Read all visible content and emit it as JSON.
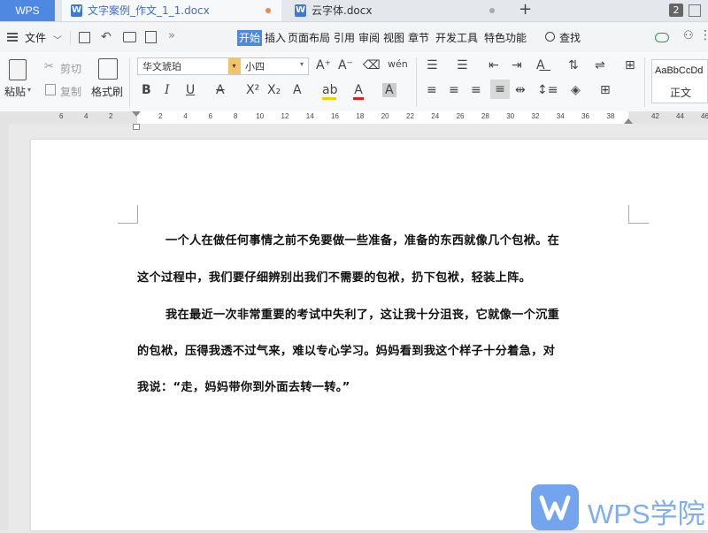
{
  "tabs": {
    "wps_label": "WPS",
    "doc1": "文字案例_作文_1_1.docx",
    "doc2": "云字体.docx",
    "add_icon": "+",
    "window_count": "2"
  },
  "menu": {
    "file_label": "文件",
    "items": [
      "开始",
      "插入",
      "页面布局",
      "引用",
      "审阅",
      "视图",
      "章节",
      "开发工具",
      "特色功能"
    ],
    "search_label": "查找"
  },
  "ribbon": {
    "paste_label": "粘贴",
    "cut_label": "剪切",
    "copy_label": "复制",
    "format_painter_label": "格式刷",
    "font_name": "华文琥珀",
    "font_size": "小四",
    "style_preview": "AaBbCcDd",
    "style_name": "正文",
    "fmt_buttons": [
      "B",
      "I",
      "U",
      "A",
      "X²",
      "X₂",
      "A",
      "A",
      "A"
    ]
  },
  "ruler": {
    "left_ticks": [
      "6",
      "4",
      "2"
    ],
    "right_ticks": [
      "2",
      "4",
      "6",
      "8",
      "10",
      "12",
      "14",
      "16",
      "18",
      "20",
      "22",
      "24",
      "26",
      "28",
      "30",
      "32",
      "34",
      "36",
      "38"
    ],
    "far_ticks": [
      "42",
      "44",
      "46"
    ]
  },
  "document": {
    "para1_line1": "一个人在做任何事情之前不免要做一些准备，准备的东西就像几个包袱。在",
    "para1_line2": "这个过程中，我们要仔细辨别出我们不需要的包袱，扔下包袱，轻装上阵。",
    "para2_line1": "我在最近一次非常重要的考试中失利了，这让我十分沮丧，它就像一个沉重",
    "para2_line2": "的包袱，压得我透不过气来，难以专心学习。妈妈看到我这个样子十分着急，对",
    "para2_line3": "我说：“走，妈妈带你到外面去转一转。”"
  },
  "watermark": {
    "text": "WPS学院"
  },
  "colors": {
    "accent": "#4f88e0",
    "tab_dot": "#f08a3c"
  }
}
